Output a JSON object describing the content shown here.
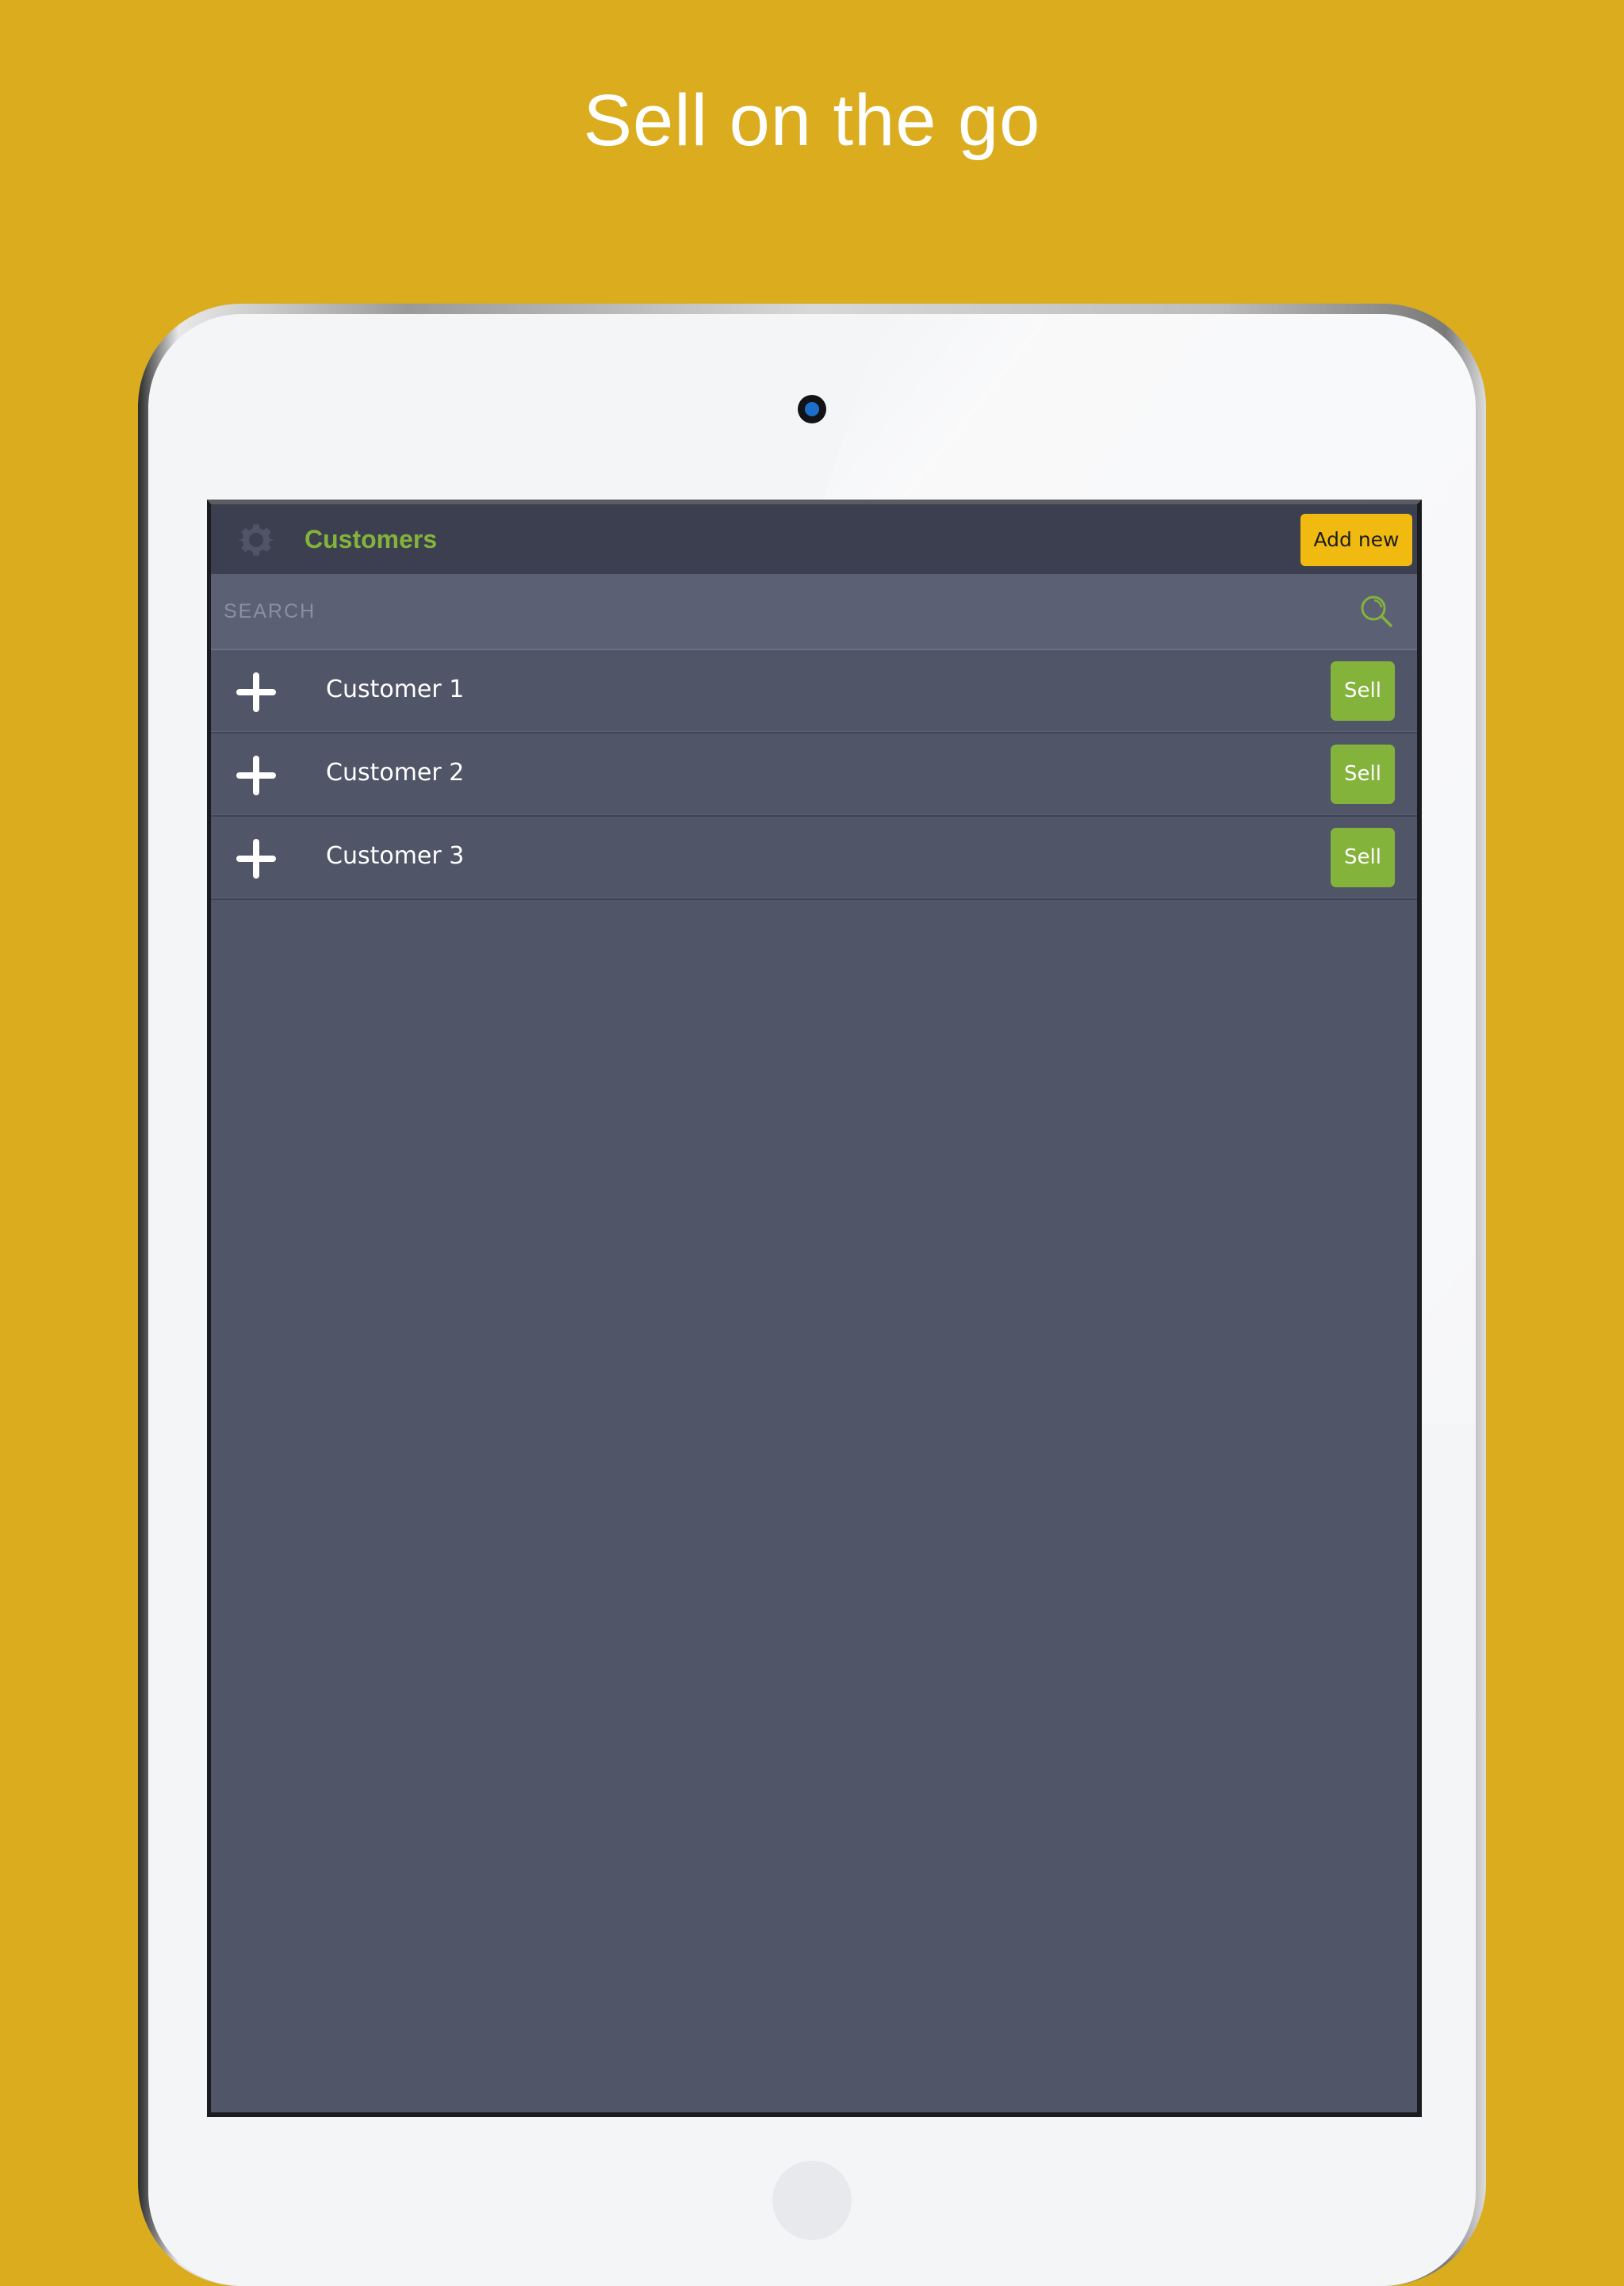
{
  "promo": {
    "headline": "Sell on the go"
  },
  "colors": {
    "background": "#DAAC1E",
    "header_bg": "#3C3F4F",
    "search_bg": "#5B6075",
    "list_bg": "#505568",
    "accent_green": "#84B33B",
    "accent_yellow": "#F0BA10"
  },
  "app": {
    "header": {
      "settings_icon": "gear-icon",
      "title": "Customers",
      "add_new_label": "Add new"
    },
    "search": {
      "placeholder": "SEARCH",
      "value": "",
      "icon": "search-icon"
    },
    "customers": [
      {
        "name": "Customer 1",
        "expand_icon": "plus-icon",
        "sell_label": "Sell"
      },
      {
        "name": "Customer 2",
        "expand_icon": "plus-icon",
        "sell_label": "Sell"
      },
      {
        "name": "Customer 3",
        "expand_icon": "plus-icon",
        "sell_label": "Sell"
      }
    ]
  }
}
